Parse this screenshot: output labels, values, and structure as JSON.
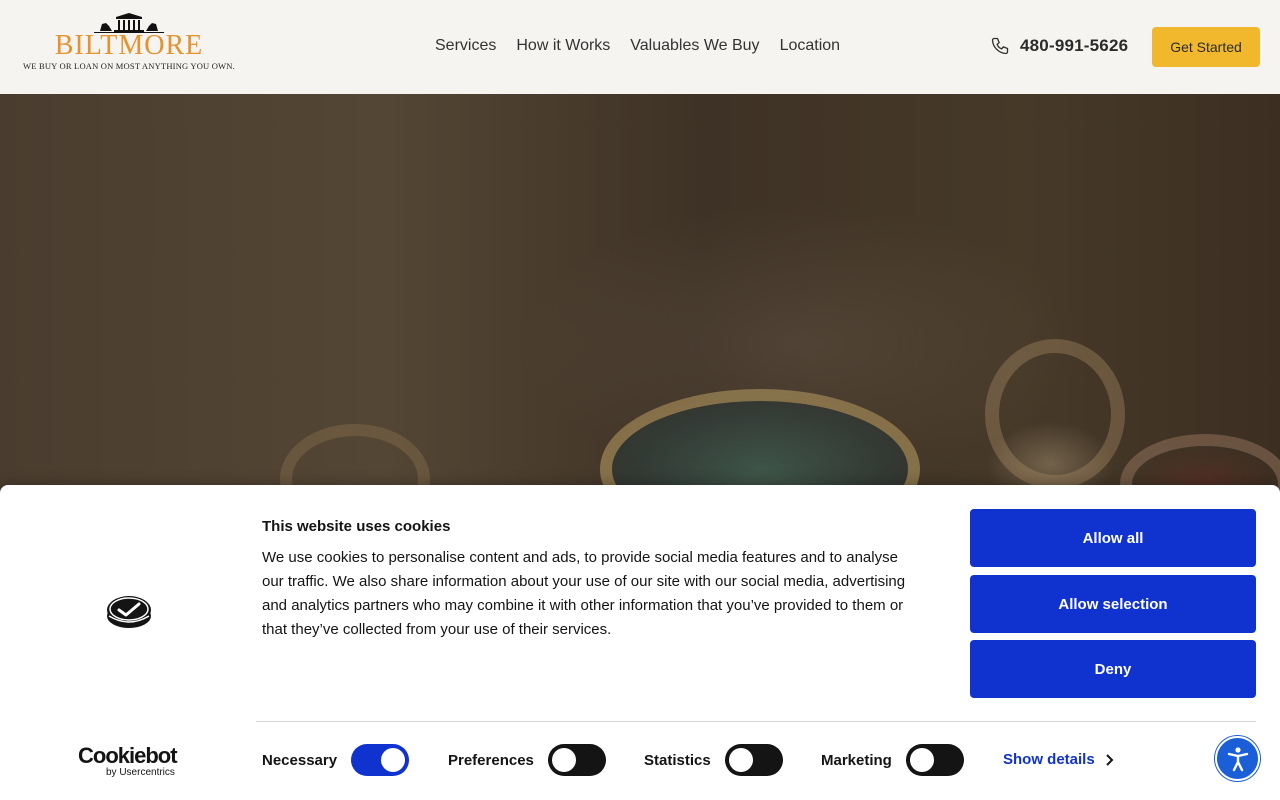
{
  "header": {
    "logo_name": "BILTMORE",
    "logo_tagline": "WE BUY OR LOAN ON MOST ANYTHING YOU OWN.",
    "nav": [
      "Services",
      "How it Works",
      "Valuables We Buy",
      "Location"
    ],
    "phone": "480-991-5626",
    "cta_label": "Get Started"
  },
  "cookie_banner": {
    "title": "This website uses cookies",
    "body": "We use cookies to personalise content and ads, to provide social media features and to analyse our traffic. We also share information about your use of our site with our social media, advertising and analytics partners who may combine it with other information that you’ve provided to them or that they’ve collected from your use of their services.",
    "buttons": {
      "allow_all": "Allow all",
      "allow_selection": "Allow selection",
      "deny": "Deny"
    },
    "toggles": [
      {
        "label": "Necessary",
        "on": true
      },
      {
        "label": "Preferences",
        "on": false
      },
      {
        "label": "Statistics",
        "on": false
      },
      {
        "label": "Marketing",
        "on": false
      }
    ],
    "show_details": "Show details",
    "brand_name": "Cookiebot",
    "brand_by": "by Usercentrics"
  },
  "colors": {
    "accent": "#f1b82d",
    "logo": "#e5922f",
    "cookie_primary": "#1032cf",
    "accessibility": "#1a5ed8"
  },
  "icons": {
    "phone": "phone-icon",
    "cookie_logo": "cookiebot-logo-icon",
    "accessibility": "accessibility-icon",
    "chevron": "chevron-right-icon"
  }
}
